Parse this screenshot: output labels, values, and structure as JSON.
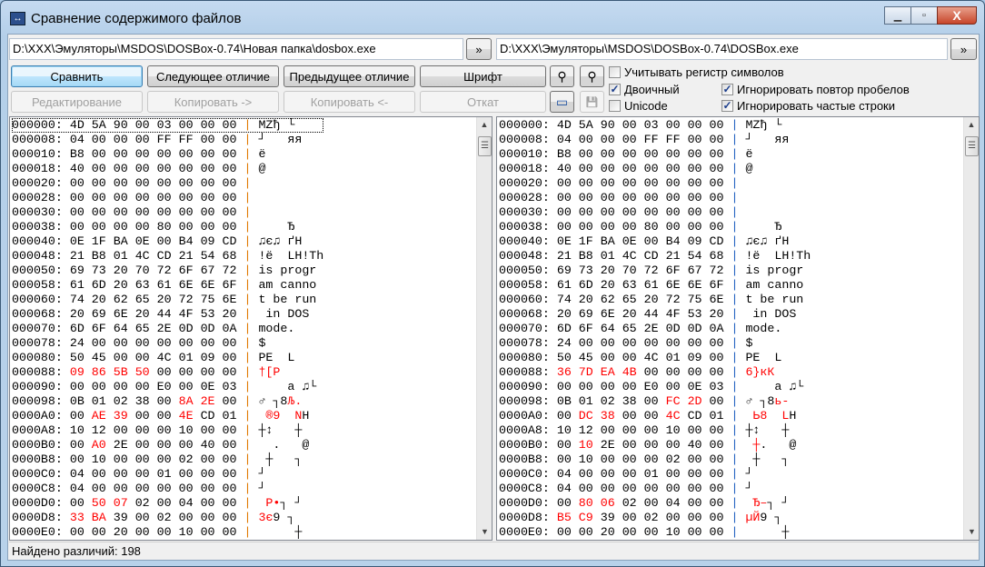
{
  "window": {
    "title": "Сравнение содержимого файлов",
    "minimize": "▁",
    "maximize": "▫",
    "close": "X"
  },
  "paths": {
    "left": "D:\\XXX\\Эмуляторы\\MSDOS\\DOSBox-0.74\\Новая папка\\dosbox.exe",
    "right": "D:\\XXX\\Эмуляторы\\MSDOS\\DOSBox-0.74\\DOSBox.exe",
    "browse": "»"
  },
  "toolbar": {
    "compare": "Сравнить",
    "next_diff": "Следующее отличие",
    "prev_diff": "Предыдущее отличие",
    "font": "Шрифт",
    "edit": "Редактирование",
    "copy_right": "Копировать ->",
    "copy_left": "Копировать <-",
    "rollback": "Откат",
    "find_icon": "⚲",
    "find_next_icon": "⚲",
    "panel_icon": "▭",
    "save_icon": "💾"
  },
  "options": {
    "case_sensitive": {
      "label": "Учитывать регистр символов",
      "checked": false
    },
    "binary": {
      "label": "Двоичный",
      "checked": true
    },
    "unicode": {
      "label": "Unicode",
      "checked": false
    },
    "ignore_spaces": {
      "label": "Игнорировать повтор пробелов",
      "checked": true
    },
    "ignore_frequent": {
      "label": "Игнорировать частые строки",
      "checked": true
    }
  },
  "colors": {
    "diff": "#ff0000",
    "left_separator": "#e07800",
    "right_separator": "#2060c0"
  },
  "left": [
    {
      "off": "000000:",
      "hex": [
        "4D",
        "5A",
        "90",
        "00",
        "03",
        "00",
        "00",
        "00"
      ],
      "diff": [],
      "ascii": [
        [
          "MZђ └",
          0
        ]
      ]
    },
    {
      "off": "000008:",
      "hex": [
        "04",
        "00",
        "00",
        "00",
        "FF",
        "FF",
        "00",
        "00"
      ],
      "diff": [],
      "ascii": [
        [
          "┘   яя",
          0
        ]
      ]
    },
    {
      "off": "000010:",
      "hex": [
        "B8",
        "00",
        "00",
        "00",
        "00",
        "00",
        "00",
        "00"
      ],
      "diff": [],
      "ascii": [
        [
          "ё",
          0
        ]
      ]
    },
    {
      "off": "000018:",
      "hex": [
        "40",
        "00",
        "00",
        "00",
        "00",
        "00",
        "00",
        "00"
      ],
      "diff": [],
      "ascii": [
        [
          "@",
          0
        ]
      ]
    },
    {
      "off": "000020:",
      "hex": [
        "00",
        "00",
        "00",
        "00",
        "00",
        "00",
        "00",
        "00"
      ],
      "diff": [],
      "ascii": []
    },
    {
      "off": "000028:",
      "hex": [
        "00",
        "00",
        "00",
        "00",
        "00",
        "00",
        "00",
        "00"
      ],
      "diff": [],
      "ascii": []
    },
    {
      "off": "000030:",
      "hex": [
        "00",
        "00",
        "00",
        "00",
        "00",
        "00",
        "00",
        "00"
      ],
      "diff": [],
      "ascii": []
    },
    {
      "off": "000038:",
      "hex": [
        "00",
        "00",
        "00",
        "00",
        "80",
        "00",
        "00",
        "00"
      ],
      "diff": [],
      "ascii": [
        [
          "    Ђ",
          0
        ]
      ]
    },
    {
      "off": "000040:",
      "hex": [
        "0E",
        "1F",
        "BA",
        "0E",
        "00",
        "B4",
        "09",
        "CD"
      ],
      "diff": [],
      "ascii": [
        [
          "♫є♫ ґН",
          0
        ]
      ]
    },
    {
      "off": "000048:",
      "hex": [
        "21",
        "B8",
        "01",
        "4C",
        "CD",
        "21",
        "54",
        "68"
      ],
      "diff": [],
      "ascii": [
        [
          "!ё  LH!Th",
          0
        ]
      ]
    },
    {
      "off": "000050:",
      "hex": [
        "69",
        "73",
        "20",
        "70",
        "72",
        "6F",
        "67",
        "72"
      ],
      "diff": [],
      "ascii": [
        [
          "is progr",
          0
        ]
      ]
    },
    {
      "off": "000058:",
      "hex": [
        "61",
        "6D",
        "20",
        "63",
        "61",
        "6E",
        "6E",
        "6F"
      ],
      "diff": [],
      "ascii": [
        [
          "am canno",
          0
        ]
      ]
    },
    {
      "off": "000060:",
      "hex": [
        "74",
        "20",
        "62",
        "65",
        "20",
        "72",
        "75",
        "6E"
      ],
      "diff": [],
      "ascii": [
        [
          "t be run",
          0
        ]
      ]
    },
    {
      "off": "000068:",
      "hex": [
        "20",
        "69",
        "6E",
        "20",
        "44",
        "4F",
        "53",
        "20"
      ],
      "diff": [],
      "ascii": [
        [
          " in DOS",
          0
        ]
      ]
    },
    {
      "off": "000070:",
      "hex": [
        "6D",
        "6F",
        "64",
        "65",
        "2E",
        "0D",
        "0D",
        "0A"
      ],
      "diff": [],
      "ascii": [
        [
          "mode.",
          0
        ]
      ]
    },
    {
      "off": "000078:",
      "hex": [
        "24",
        "00",
        "00",
        "00",
        "00",
        "00",
        "00",
        "00"
      ],
      "diff": [],
      "ascii": [
        [
          "$",
          0
        ]
      ]
    },
    {
      "off": "000080:",
      "hex": [
        "50",
        "45",
        "00",
        "00",
        "4C",
        "01",
        "09",
        "00"
      ],
      "diff": [],
      "ascii": [
        [
          "PE  L",
          0
        ]
      ]
    },
    {
      "off": "000088:",
      "hex": [
        "09",
        "86",
        "5B",
        "50",
        "00",
        "00",
        "00",
        "00"
      ],
      "diff": [
        0,
        1,
        2,
        3
      ],
      "ascii": [
        [
          "†[P",
          1
        ]
      ]
    },
    {
      "off": "000090:",
      "hex": [
        "00",
        "00",
        "00",
        "00",
        "E0",
        "00",
        "0E",
        "03"
      ],
      "diff": [],
      "ascii": [
        [
          "    а ♫└",
          0
        ]
      ]
    },
    {
      "off": "000098:",
      "hex": [
        "0B",
        "01",
        "02",
        "38",
        "00",
        "8A",
        "2E",
        "00"
      ],
      "diff": [
        5,
        6
      ],
      "ascii": [
        [
          "♂ ┐8",
          0
        ],
        [
          "Љ.",
          1
        ]
      ]
    },
    {
      "off": "0000A0:",
      "hex": [
        "00",
        "AE",
        "39",
        "00",
        "00",
        "4E",
        "CD",
        "01"
      ],
      "diff": [
        1,
        2,
        5
      ],
      "ascii": [
        [
          " ",
          0
        ],
        [
          "®9",
          1
        ],
        [
          "  ",
          0
        ],
        [
          "N",
          1
        ],
        [
          "Н",
          0
        ]
      ]
    },
    {
      "off": "0000A8:",
      "hex": [
        "10",
        "12",
        "00",
        "00",
        "00",
        "10",
        "00",
        "00"
      ],
      "diff": [],
      "ascii": [
        [
          "┼↕   ┼",
          0
        ]
      ]
    },
    {
      "off": "0000B0:",
      "hex": [
        "00",
        "A0",
        "2E",
        "00",
        "00",
        "00",
        "40",
        "00"
      ],
      "diff": [
        1
      ],
      "ascii": [
        [
          "  .   @",
          0
        ]
      ]
    },
    {
      "off": "0000B8:",
      "hex": [
        "00",
        "10",
        "00",
        "00",
        "00",
        "02",
        "00",
        "00"
      ],
      "diff": [],
      "ascii": [
        [
          " ┼   ┐",
          0
        ]
      ]
    },
    {
      "off": "0000C0:",
      "hex": [
        "04",
        "00",
        "00",
        "00",
        "01",
        "00",
        "00",
        "00"
      ],
      "diff": [],
      "ascii": [
        [
          "┘",
          0
        ]
      ]
    },
    {
      "off": "0000C8:",
      "hex": [
        "04",
        "00",
        "00",
        "00",
        "00",
        "00",
        "00",
        "00"
      ],
      "diff": [],
      "ascii": [
        [
          "┘",
          0
        ]
      ]
    },
    {
      "off": "0000D0:",
      "hex": [
        "00",
        "50",
        "07",
        "02",
        "00",
        "04",
        "00",
        "00"
      ],
      "diff": [
        1,
        2
      ],
      "ascii": [
        [
          " ",
          0
        ],
        [
          "P•",
          1
        ],
        [
          "┐ ┘",
          0
        ]
      ]
    },
    {
      "off": "0000D8:",
      "hex": [
        "33",
        "BA",
        "39",
        "00",
        "02",
        "00",
        "00",
        "00"
      ],
      "diff": [
        0,
        1
      ],
      "ascii": [
        [
          "3є",
          1
        ],
        [
          "9 ┐",
          0
        ]
      ]
    },
    {
      "off": "0000E0:",
      "hex": [
        "00",
        "00",
        "20",
        "00",
        "00",
        "10",
        "00",
        "00"
      ],
      "diff": [],
      "ascii": [
        [
          "     ┼",
          0
        ]
      ]
    }
  ],
  "right": [
    {
      "off": "000000:",
      "hex": [
        "4D",
        "5A",
        "90",
        "00",
        "03",
        "00",
        "00",
        "00"
      ],
      "diff": [],
      "ascii": [
        [
          "MZђ └",
          0
        ]
      ]
    },
    {
      "off": "000008:",
      "hex": [
        "04",
        "00",
        "00",
        "00",
        "FF",
        "FF",
        "00",
        "00"
      ],
      "diff": [],
      "ascii": [
        [
          "┘   яя",
          0
        ]
      ]
    },
    {
      "off": "000010:",
      "hex": [
        "B8",
        "00",
        "00",
        "00",
        "00",
        "00",
        "00",
        "00"
      ],
      "diff": [],
      "ascii": [
        [
          "ё",
          0
        ]
      ]
    },
    {
      "off": "000018:",
      "hex": [
        "40",
        "00",
        "00",
        "00",
        "00",
        "00",
        "00",
        "00"
      ],
      "diff": [],
      "ascii": [
        [
          "@",
          0
        ]
      ]
    },
    {
      "off": "000020:",
      "hex": [
        "00",
        "00",
        "00",
        "00",
        "00",
        "00",
        "00",
        "00"
      ],
      "diff": [],
      "ascii": []
    },
    {
      "off": "000028:",
      "hex": [
        "00",
        "00",
        "00",
        "00",
        "00",
        "00",
        "00",
        "00"
      ],
      "diff": [],
      "ascii": []
    },
    {
      "off": "000030:",
      "hex": [
        "00",
        "00",
        "00",
        "00",
        "00",
        "00",
        "00",
        "00"
      ],
      "diff": [],
      "ascii": []
    },
    {
      "off": "000038:",
      "hex": [
        "00",
        "00",
        "00",
        "00",
        "80",
        "00",
        "00",
        "00"
      ],
      "diff": [],
      "ascii": [
        [
          "    Ђ",
          0
        ]
      ]
    },
    {
      "off": "000040:",
      "hex": [
        "0E",
        "1F",
        "BA",
        "0E",
        "00",
        "B4",
        "09",
        "CD"
      ],
      "diff": [],
      "ascii": [
        [
          "♫є♫ ґН",
          0
        ]
      ]
    },
    {
      "off": "000048:",
      "hex": [
        "21",
        "B8",
        "01",
        "4C",
        "CD",
        "21",
        "54",
        "68"
      ],
      "diff": [],
      "ascii": [
        [
          "!ё  LH!Th",
          0
        ]
      ]
    },
    {
      "off": "000050:",
      "hex": [
        "69",
        "73",
        "20",
        "70",
        "72",
        "6F",
        "67",
        "72"
      ],
      "diff": [],
      "ascii": [
        [
          "is progr",
          0
        ]
      ]
    },
    {
      "off": "000058:",
      "hex": [
        "61",
        "6D",
        "20",
        "63",
        "61",
        "6E",
        "6E",
        "6F"
      ],
      "diff": [],
      "ascii": [
        [
          "am canno",
          0
        ]
      ]
    },
    {
      "off": "000060:",
      "hex": [
        "74",
        "20",
        "62",
        "65",
        "20",
        "72",
        "75",
        "6E"
      ],
      "diff": [],
      "ascii": [
        [
          "t be run",
          0
        ]
      ]
    },
    {
      "off": "000068:",
      "hex": [
        "20",
        "69",
        "6E",
        "20",
        "44",
        "4F",
        "53",
        "20"
      ],
      "diff": [],
      "ascii": [
        [
          " in DOS",
          0
        ]
      ]
    },
    {
      "off": "000070:",
      "hex": [
        "6D",
        "6F",
        "64",
        "65",
        "2E",
        "0D",
        "0D",
        "0A"
      ],
      "diff": [],
      "ascii": [
        [
          "mode.",
          0
        ]
      ]
    },
    {
      "off": "000078:",
      "hex": [
        "24",
        "00",
        "00",
        "00",
        "00",
        "00",
        "00",
        "00"
      ],
      "diff": [],
      "ascii": [
        [
          "$",
          0
        ]
      ]
    },
    {
      "off": "000080:",
      "hex": [
        "50",
        "45",
        "00",
        "00",
        "4C",
        "01",
        "09",
        "00"
      ],
      "diff": [],
      "ascii": [
        [
          "PE  L",
          0
        ]
      ]
    },
    {
      "off": "000088:",
      "hex": [
        "36",
        "7D",
        "EA",
        "4B",
        "00",
        "00",
        "00",
        "00"
      ],
      "diff": [
        0,
        1,
        2,
        3
      ],
      "ascii": [
        [
          "6}кК",
          1
        ]
      ]
    },
    {
      "off": "000090:",
      "hex": [
        "00",
        "00",
        "00",
        "00",
        "E0",
        "00",
        "0E",
        "03"
      ],
      "diff": [],
      "ascii": [
        [
          "    а ♫└",
          0
        ]
      ]
    },
    {
      "off": "000098:",
      "hex": [
        "0B",
        "01",
        "02",
        "38",
        "00",
        "FC",
        "2D",
        "00"
      ],
      "diff": [
        5,
        6
      ],
      "ascii": [
        [
          "♂ ┐8",
          0
        ],
        [
          "ь-",
          1
        ]
      ]
    },
    {
      "off": "0000A0:",
      "hex": [
        "00",
        "DC",
        "38",
        "00",
        "00",
        "4C",
        "CD",
        "01"
      ],
      "diff": [
        1,
        2,
        5
      ],
      "ascii": [
        [
          " ",
          0
        ],
        [
          "Ь8",
          1
        ],
        [
          "  ",
          0
        ],
        [
          "L",
          1
        ],
        [
          "Н",
          0
        ]
      ]
    },
    {
      "off": "0000A8:",
      "hex": [
        "10",
        "12",
        "00",
        "00",
        "00",
        "10",
        "00",
        "00"
      ],
      "diff": [],
      "ascii": [
        [
          "┼↕   ┼",
          0
        ]
      ]
    },
    {
      "off": "0000B0:",
      "hex": [
        "00",
        "10",
        "2E",
        "00",
        "00",
        "00",
        "40",
        "00"
      ],
      "diff": [
        1
      ],
      "ascii": [
        [
          " ",
          0
        ],
        [
          "┼",
          1
        ],
        [
          ".   @",
          0
        ]
      ]
    },
    {
      "off": "0000B8:",
      "hex": [
        "00",
        "10",
        "00",
        "00",
        "00",
        "02",
        "00",
        "00"
      ],
      "diff": [],
      "ascii": [
        [
          " ┼   ┐",
          0
        ]
      ]
    },
    {
      "off": "0000C0:",
      "hex": [
        "04",
        "00",
        "00",
        "00",
        "01",
        "00",
        "00",
        "00"
      ],
      "diff": [],
      "ascii": [
        [
          "┘",
          0
        ]
      ]
    },
    {
      "off": "0000C8:",
      "hex": [
        "04",
        "00",
        "00",
        "00",
        "00",
        "00",
        "00",
        "00"
      ],
      "diff": [],
      "ascii": [
        [
          "┘",
          0
        ]
      ]
    },
    {
      "off": "0000D0:",
      "hex": [
        "00",
        "80",
        "06",
        "02",
        "00",
        "04",
        "00",
        "00"
      ],
      "diff": [
        1,
        2
      ],
      "ascii": [
        [
          " ",
          0
        ],
        [
          "Ђ–",
          1
        ],
        [
          "┐ ┘",
          0
        ]
      ]
    },
    {
      "off": "0000D8:",
      "hex": [
        "B5",
        "C9",
        "39",
        "00",
        "02",
        "00",
        "00",
        "00"
      ],
      "diff": [
        0,
        1
      ],
      "ascii": [
        [
          "µЙ",
          1
        ],
        [
          "9 ┐",
          0
        ]
      ]
    },
    {
      "off": "0000E0:",
      "hex": [
        "00",
        "00",
        "20",
        "00",
        "00",
        "10",
        "00",
        "00"
      ],
      "diff": [],
      "ascii": [
        [
          "     ┼",
          0
        ]
      ]
    }
  ],
  "scroll": {
    "up": "▲",
    "down": "▼",
    "grip": "☰"
  },
  "status": "Найдено различий: 198"
}
